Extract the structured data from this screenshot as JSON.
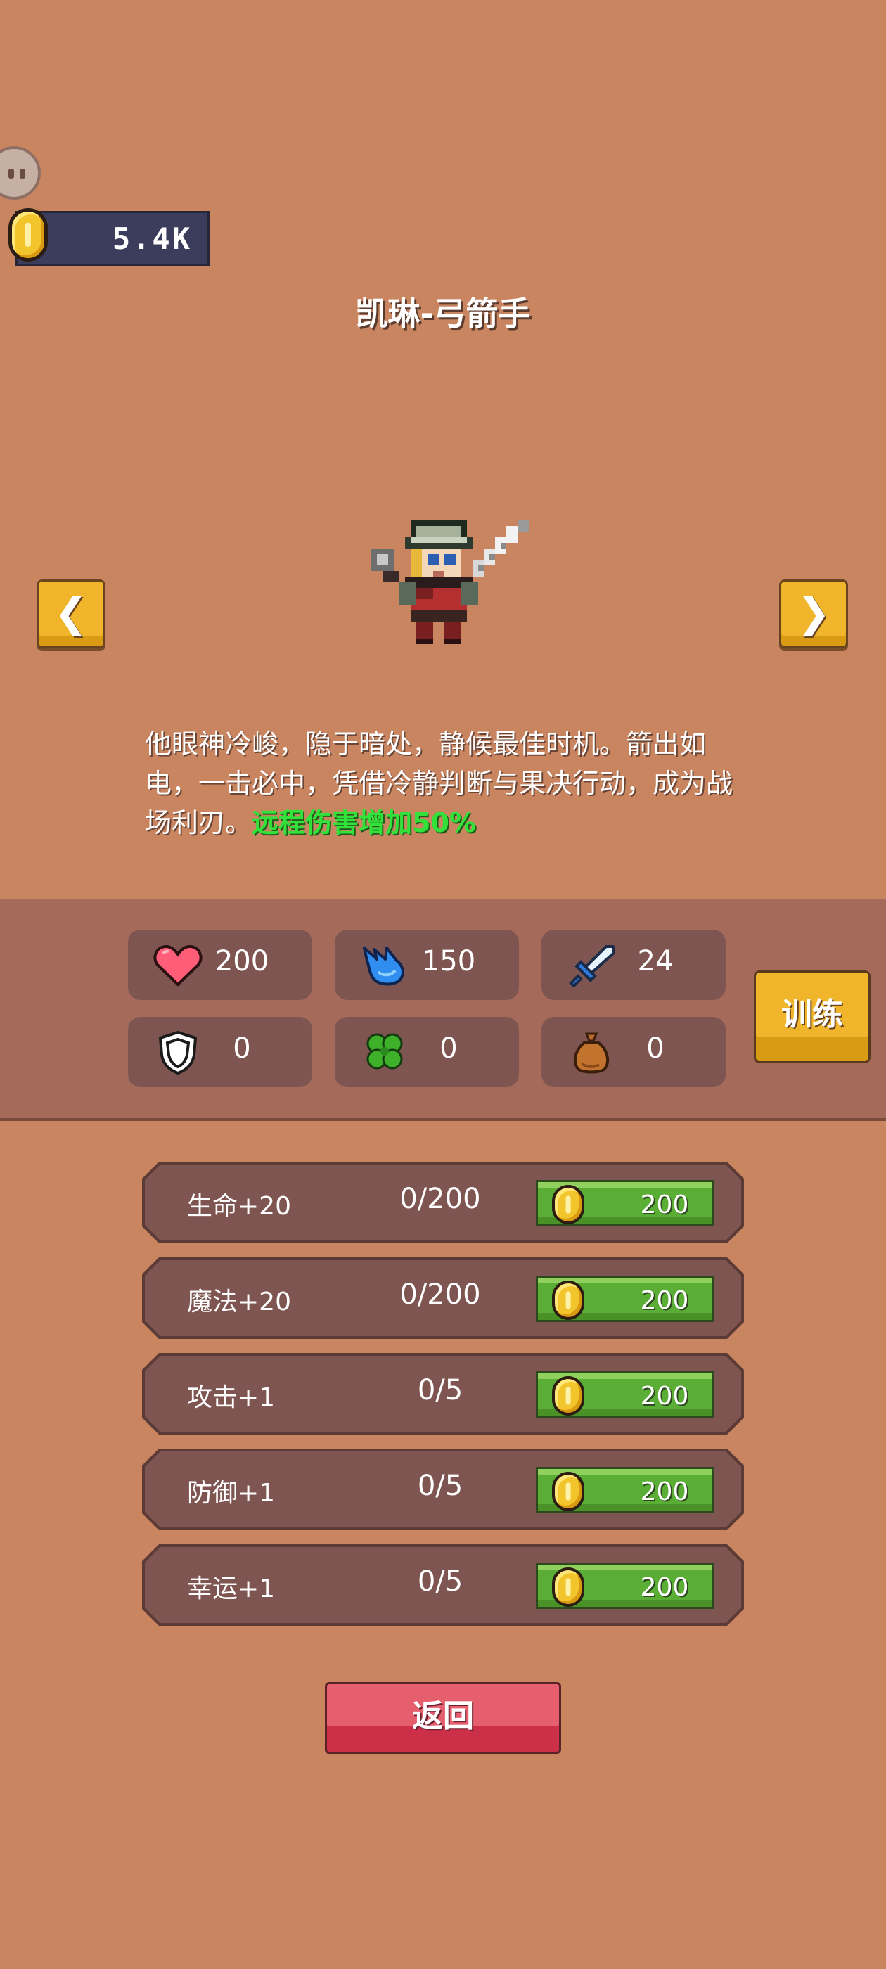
{
  "header": {
    "coins": "5.4K",
    "title": "凯琳-弓箭手"
  },
  "nav": {
    "prev": "❮",
    "next": "❯"
  },
  "description": {
    "text": "他眼神冷峻，隐于暗处，静候最佳时机。箭出如电，一击必中，凭借冷静判断与果决行动，成为战场利刃。",
    "highlight": "远程伤害增加50%"
  },
  "stats": [
    {
      "icon": "heart-icon",
      "value": "200"
    },
    {
      "icon": "mana-icon",
      "value": "150"
    },
    {
      "icon": "sword-icon",
      "value": "24"
    },
    {
      "icon": "shield-icon",
      "value": "0"
    },
    {
      "icon": "clover-icon",
      "value": "0"
    },
    {
      "icon": "money-bag-icon",
      "value": "0"
    }
  ],
  "train_label": "训练",
  "upgrades": [
    {
      "label": "生命+20",
      "progress": "0/200",
      "price": "200"
    },
    {
      "label": "魔法+20",
      "progress": "0/200",
      "price": "200"
    },
    {
      "label": "攻击+1",
      "progress": "0/5",
      "price": "200"
    },
    {
      "label": "防御+1",
      "progress": "0/5",
      "price": "200"
    },
    {
      "label": "幸运+1",
      "progress": "0/5",
      "price": "200"
    }
  ],
  "back_label": "返回",
  "colors": {
    "background": "#c98560",
    "panel": "#a66a5b",
    "gold_button": "#f0b52a",
    "buy_button": "#5aae36",
    "back_button": "#e55f6e",
    "highlight_text": "#32e13a"
  }
}
